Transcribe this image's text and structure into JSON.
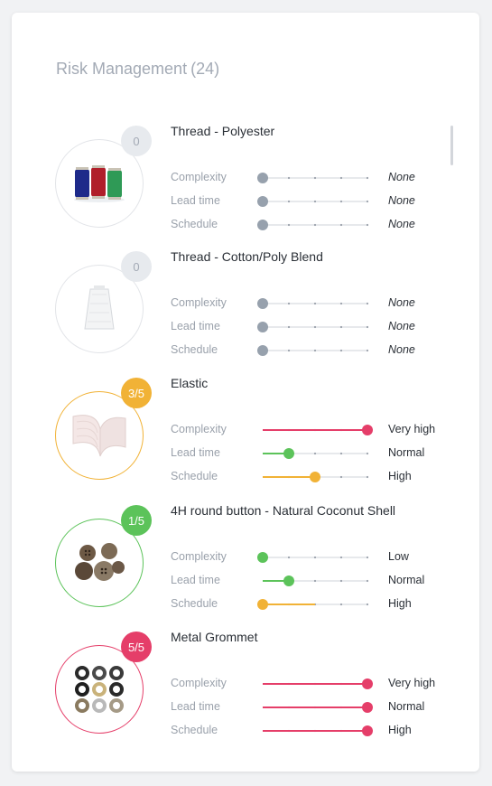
{
  "header": {
    "title": "Risk Management",
    "count": "(24)"
  },
  "colors": {
    "none": "#97a1ad",
    "low": "#5cc35a",
    "medium": "#f1b236",
    "high": "#e53e69",
    "track": "#dfe2e6",
    "tick": "#9aa1ab"
  },
  "items": [
    {
      "name": "Thread - Polyester",
      "badge": "0",
      "badge_color": "#e7eaee",
      "badge_text_color": "#a3aab5",
      "ring_color": "#e2e4e8",
      "image": "thread-spools-icon",
      "rows": [
        {
          "label": "Complexity",
          "value": "None",
          "level": 0,
          "color": "#97a1ad"
        },
        {
          "label": "Lead time",
          "value": "None",
          "level": 0,
          "color": "#97a1ad"
        },
        {
          "label": "Schedule",
          "value": "None",
          "level": 0,
          "color": "#97a1ad"
        }
      ]
    },
    {
      "name": "Thread - Cotton/Poly Blend",
      "badge": "0",
      "badge_color": "#e7eaee",
      "badge_text_color": "#a3aab5",
      "ring_color": "#e2e4e8",
      "image": "thread-cone-icon",
      "rows": [
        {
          "label": "Complexity",
          "value": "None",
          "level": 0,
          "color": "#97a1ad"
        },
        {
          "label": "Lead time",
          "value": "None",
          "level": 0,
          "color": "#97a1ad"
        },
        {
          "label": "Schedule",
          "value": "None",
          "level": 0,
          "color": "#97a1ad"
        }
      ]
    },
    {
      "name": "Elastic",
      "badge": "3/5",
      "badge_color": "#f1b236",
      "badge_text_color": "#ffffff",
      "ring_color": "#f1b236",
      "image": "elastic-band-icon",
      "rows": [
        {
          "label": "Complexity",
          "value": "Very high",
          "level": 4,
          "color": "#e53e69"
        },
        {
          "label": "Lead time",
          "value": "Normal",
          "level": 1,
          "color": "#5cc35a"
        },
        {
          "label": "Schedule",
          "value": "High",
          "level": 2,
          "color": "#f1b236"
        }
      ]
    },
    {
      "name": "4H round button - Natural Coconut Shell",
      "badge": "1/5",
      "badge_color": "#5cc35a",
      "badge_text_color": "#ffffff",
      "ring_color": "#5cc35a",
      "image": "coconut-buttons-icon",
      "rows": [
        {
          "label": "Complexity",
          "value": "Low",
          "level": 0,
          "color": "#5cc35a"
        },
        {
          "label": "Lead time",
          "value": "Normal",
          "level": 1,
          "color": "#5cc35a"
        },
        {
          "label": "Schedule",
          "value": "High",
          "level": 0,
          "color": "#f1b236",
          "line_to": 2
        }
      ]
    },
    {
      "name": "Metal Grommet",
      "badge": "5/5",
      "badge_color": "#e53e69",
      "badge_text_color": "#ffffff",
      "ring_color": "#e53e69",
      "image": "metal-grommets-icon",
      "rows": [
        {
          "label": "Complexity",
          "value": "Very high",
          "level": 4,
          "color": "#e53e69"
        },
        {
          "label": "Lead time",
          "value": "Normal",
          "level": 4,
          "color": "#e53e69"
        },
        {
          "label": "Schedule",
          "value": "High",
          "level": 4,
          "color": "#e53e69"
        }
      ]
    }
  ]
}
